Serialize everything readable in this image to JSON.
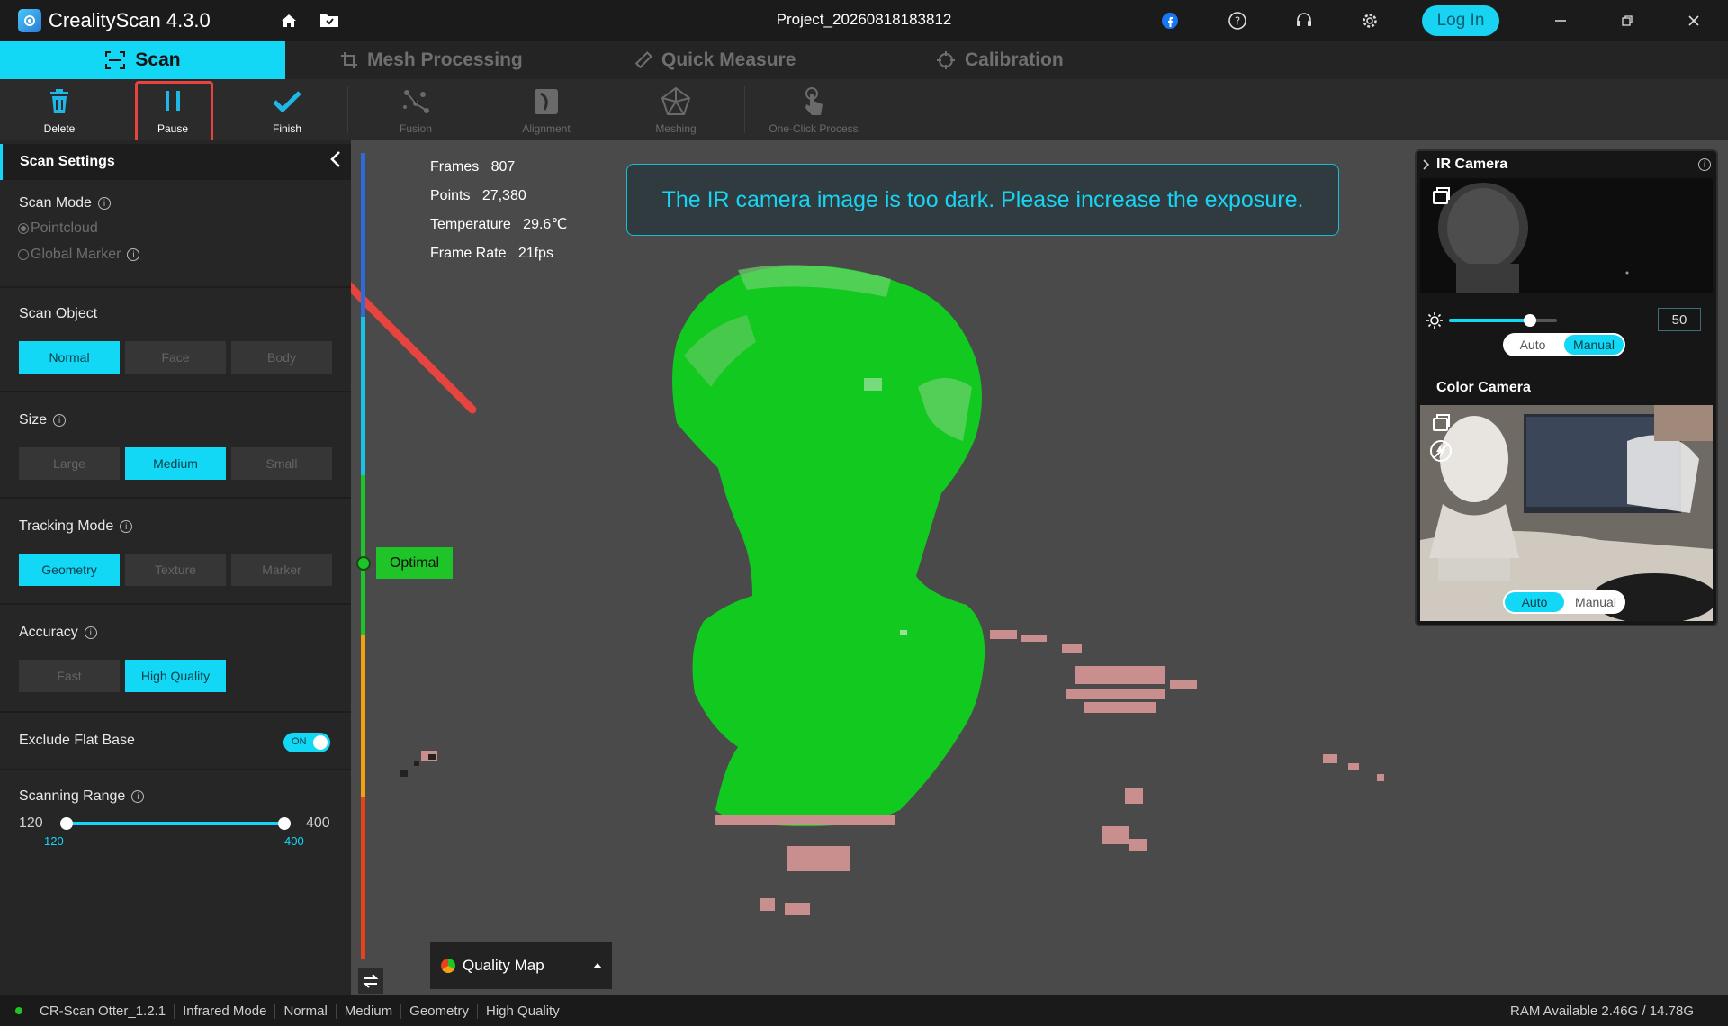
{
  "app": {
    "title": "CrealityScan 4.3.0",
    "project": "Project_20260818183812",
    "login_label": "Log In"
  },
  "main_tabs": [
    {
      "label": "Scan"
    },
    {
      "label": "Mesh Processing"
    },
    {
      "label": "Quick Measure"
    },
    {
      "label": "Calibration"
    }
  ],
  "toolbar": {
    "delete": "Delete",
    "pause": "Pause",
    "finish": "Finish",
    "fusion": "Fusion",
    "alignment": "Alignment",
    "meshing": "Meshing",
    "one_click": "One-Click Process"
  },
  "left_panel": {
    "title": "Scan Settings",
    "scan_mode": {
      "title": "Scan Mode",
      "options": [
        "Pointcloud",
        "Global Marker"
      ],
      "selected": "Pointcloud"
    },
    "scan_object": {
      "title": "Scan Object",
      "options": [
        "Normal",
        "Face",
        "Body"
      ],
      "selected": "Normal"
    },
    "size": {
      "title": "Size",
      "options": [
        "Large",
        "Medium",
        "Small"
      ],
      "selected": "Medium"
    },
    "tracking_mode": {
      "title": "Tracking Mode",
      "options": [
        "Geometry",
        "Texture",
        "Marker"
      ],
      "selected": "Geometry"
    },
    "accuracy": {
      "title": "Accuracy",
      "options": [
        "Fast",
        "High Quality"
      ],
      "selected": "High Quality"
    },
    "exclude_flat_base": {
      "title": "Exclude Flat Base",
      "toggle": "ON"
    },
    "scanning_range": {
      "title": "Scanning Range",
      "min": "120",
      "max": "400",
      "low": "120",
      "high": "400"
    }
  },
  "viewport": {
    "stats": [
      {
        "label": "Frames",
        "value": "807"
      },
      {
        "label": "Points",
        "value": "27,380"
      },
      {
        "label": "Temperature",
        "value": "29.6℃"
      },
      {
        "label": "Frame Rate",
        "value": "21fps"
      }
    ],
    "warning": "The IR camera image is too dark. Please increase the exposure.",
    "distance_indicator": "Optimal",
    "quality_map": "Quality Map"
  },
  "ir_panel": {
    "title": "IR Camera",
    "exposure_value": "50",
    "exposure_level": 0.75,
    "ir_modes": [
      "Auto",
      "Manual"
    ],
    "ir_selected": "Manual",
    "color_title": "Color Camera",
    "color_modes": [
      "Auto",
      "Manual"
    ],
    "color_selected": "Auto"
  },
  "status_bar": {
    "device": "CR-Scan Otter_1.2.1",
    "items": [
      "Infrared Mode",
      "Normal",
      "Medium",
      "Geometry",
      "High Quality"
    ],
    "ram": "RAM Available 2.46G / 14.78G"
  },
  "colors": {
    "accent": "#12d7f5",
    "optimal": "#1fc428",
    "annotation": "#e5443f"
  }
}
